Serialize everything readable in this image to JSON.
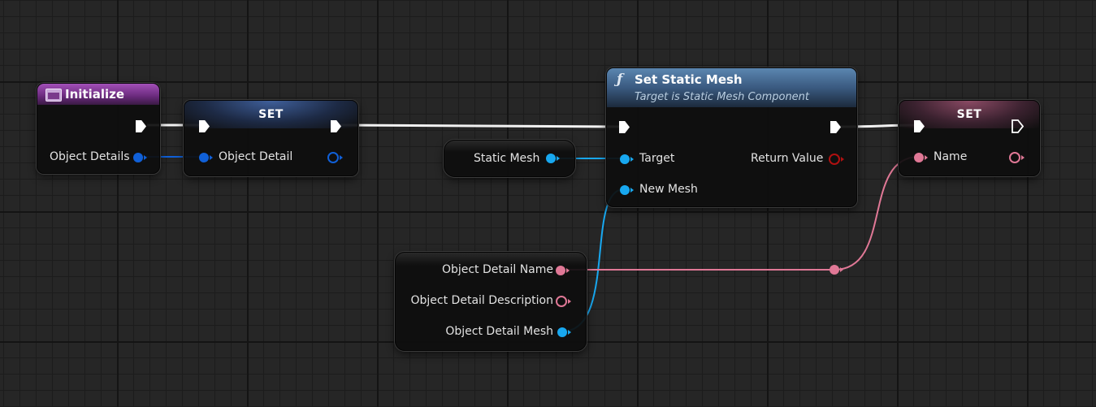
{
  "canvas": {
    "background_color": "#262626",
    "grid_major_color": "#141414",
    "grid_minor_color": "#1c1c1c"
  },
  "colors": {
    "object_reference_pin": "#1060d8",
    "mesh_reference_pin": "#18a8f0",
    "string_pin": "#e07896",
    "return_value_pin": "#b01010",
    "exec_pin": "#ffffff"
  },
  "nodes": {
    "initialize": {
      "icon": "event-graph-icon",
      "title": "Initialize",
      "output_pin": "Object Details"
    },
    "set_object_detail": {
      "title": "SET",
      "input_pin": "Object Detail"
    },
    "static_mesh_getter": {
      "output_pin": "Static Mesh"
    },
    "set_static_mesh": {
      "icon": "function-icon",
      "title": "Set Static Mesh",
      "subtitle": "Target is Static Mesh Component",
      "target_pin": "Target",
      "new_mesh_pin": "New Mesh",
      "return_pin": "Return Value"
    },
    "object_detail_break": {
      "pins": [
        "Object Detail Name",
        "Object Detail Description",
        "Object Detail Mesh"
      ]
    },
    "set_name": {
      "title": "SET",
      "input_pin": "Name"
    }
  }
}
